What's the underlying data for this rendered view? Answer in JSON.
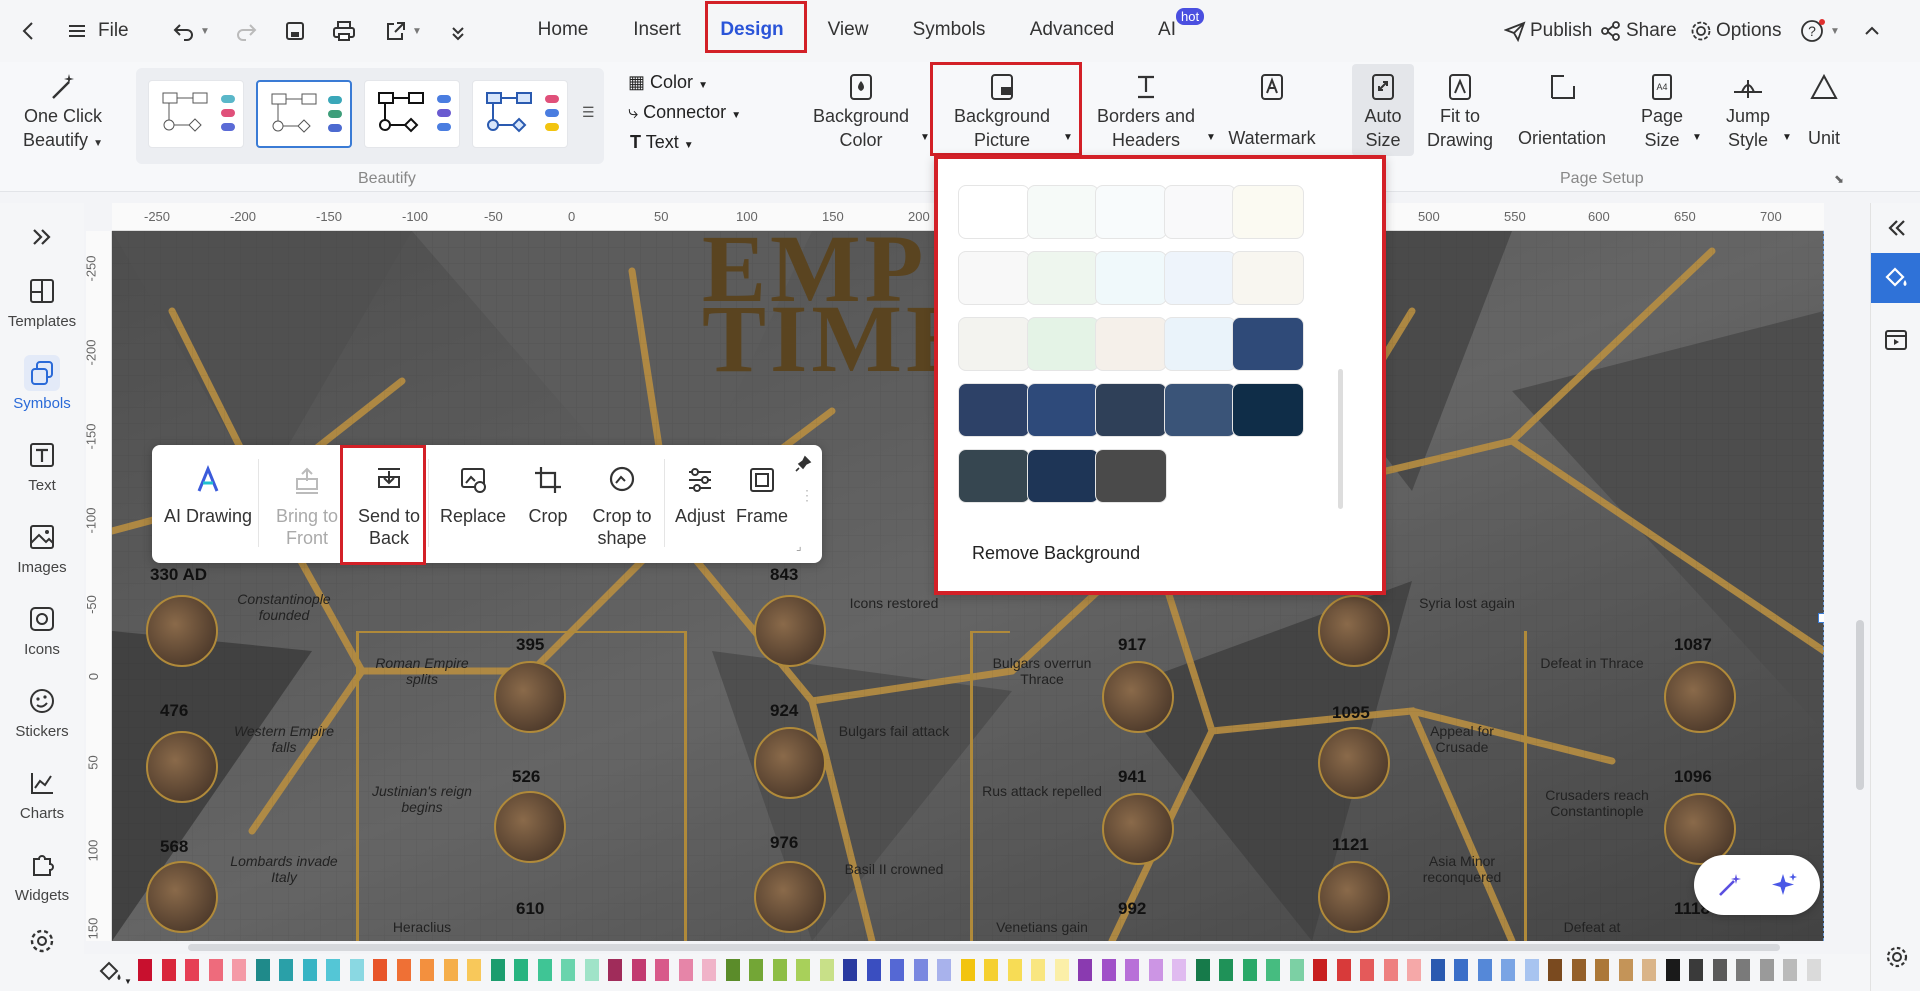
{
  "topbar": {
    "file": "File",
    "tabs": [
      "Home",
      "Insert",
      "Design",
      "View",
      "Symbols",
      "Advanced",
      "AI"
    ],
    "hot_badge": "hot",
    "publish": "Publish",
    "share": "Share",
    "options": "Options"
  },
  "ribbon": {
    "one_click_beautify": [
      "One Click",
      "Beautify"
    ],
    "beautify_label": "Beautify",
    "color": "Color",
    "connector": "Connector",
    "text": "Text",
    "background_color": [
      "Background",
      "Color"
    ],
    "background_picture": [
      "Background",
      "Picture"
    ],
    "borders_headers": [
      "Borders and",
      "Headers"
    ],
    "watermark": "Watermark",
    "auto_size": [
      "Auto",
      "Size"
    ],
    "fit_to_drawing": [
      "Fit to",
      "Drawing"
    ],
    "orientation": "Orientation",
    "page_size": [
      "Page",
      "Size"
    ],
    "jump_style": [
      "Jump",
      "Style"
    ],
    "unit": "Unit",
    "page_setup_label": "Page Setup"
  },
  "ruler_h": [
    "-250",
    "-200",
    "-150",
    "-100",
    "-50",
    "0",
    "50",
    "100",
    "150",
    "200",
    "500",
    "550",
    "600",
    "650",
    "700"
  ],
  "ruler_v": [
    "-250",
    "-200",
    "-150",
    "-100",
    "-50",
    "0",
    "50",
    "100",
    "150"
  ],
  "sidebar": [
    "Templates",
    "Symbols",
    "Text",
    "Images",
    "Icons",
    "Stickers",
    "Charts",
    "Widgets"
  ],
  "floatbar": {
    "ai_drawing": "AI Drawing",
    "bring_to_front": [
      "Bring to",
      "Front"
    ],
    "send_to_back": [
      "Send to",
      "Back"
    ],
    "replace": "Replace",
    "crop": "Crop",
    "crop_to_shape": [
      "Crop to",
      "shape"
    ],
    "adjust": "Adjust",
    "frame": "Frame"
  },
  "bgpanel": {
    "remove": "Remove Background",
    "thumb_colors": [
      "#ffffff",
      "#f6faf8",
      "#f8fbfc",
      "#f9f9fa",
      "#fbfaf2",
      "#f8f8f8",
      "#eef6ee",
      "#f0f9fb",
      "#eef4fb",
      "#f8f6f0",
      "#f3f3ef",
      "#e4f3e6",
      "#f5f0ea",
      "#eaf3fa",
      "#2f4a78",
      "#2d4167",
      "#2e4a7a",
      "#2f4058",
      "#3a5478",
      "#0f2d48",
      "#364650",
      "#1e3556",
      "#4a4a4a"
    ]
  },
  "canvas": {
    "title1": "EMP",
    "title2": "TIME",
    "years": [
      "330 AD",
      "395",
      "476",
      "526",
      "568",
      "610",
      "843",
      "924",
      "976",
      "917",
      "941",
      "992",
      "1095",
      "1121",
      "1087",
      "1096",
      "1118"
    ],
    "events": [
      "Constantinople founded",
      "Roman Empire splits",
      "Western Empire falls",
      "Justinian's reign begins",
      "Lombards invade Italy",
      "Heraclius",
      "Icons restored",
      "Bulgars fail attack",
      "Basil II crowned",
      "Bulgars overrun Thrace",
      "Rus attack repelled",
      "Venetians gain",
      "Syria lost again",
      "Appeal for Crusade",
      "Asia Minor reconquered",
      "Defeat in Thrace",
      "Crusaders reach Constantinople",
      "Defeat at"
    ]
  },
  "palette": [
    "#c8102e",
    "#d9263b",
    "#e63f55",
    "#ee6b7c",
    "#f49aa6",
    "#1f8a8a",
    "#2aa0a8",
    "#37b4c4",
    "#54c6d6",
    "#8ad8e2",
    "#e8552a",
    "#ef7035",
    "#f3903e",
    "#f5ae4a",
    "#f8c85a",
    "#1c9d6e",
    "#27b480",
    "#3fc595",
    "#6ad4ad",
    "#a0e3c8",
    "#a02c5a",
    "#c23a70",
    "#d85a8a",
    "#e685a8",
    "#f0b3c8",
    "#5b8c2a",
    "#73a636",
    "#8dbd45",
    "#a8d05a",
    "#c8e088",
    "#2a3aa0",
    "#3a4ec0",
    "#5568d4",
    "#7a88e0",
    "#a8b2ec",
    "#f2c40f",
    "#f5d030",
    "#f7dc55",
    "#f9e680",
    "#fbefa8",
    "#8a3ab0",
    "#a050c8",
    "#b870d8",
    "#cc95e4",
    "#e0bbf0",
    "#167a4a",
    "#1f9258",
    "#2aa868",
    "#46bc80",
    "#7cd0a4",
    "#c81f1f",
    "#d83a3a",
    "#e45a5a",
    "#ee8080",
    "#f5a8a8",
    "#2a5ab0",
    "#3a6ec8",
    "#5588d8",
    "#7aa4e4",
    "#a8c4f0",
    "#7a4a1f",
    "#94602a",
    "#ac7838",
    "#c49458",
    "#dab488",
    "#1a1a1a",
    "#3a3a3a",
    "#5a5a5a",
    "#7a7a7a",
    "#9a9a9a",
    "#bababa",
    "#dadada"
  ]
}
